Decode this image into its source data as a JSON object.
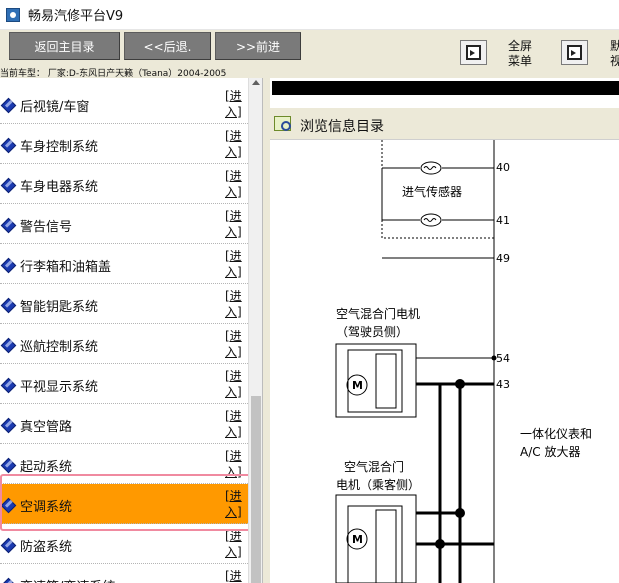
{
  "window": {
    "title": "畅易汽修平台V9"
  },
  "toolbar": {
    "back_main": "返回主目录",
    "back": "<<后退.",
    "forward": ">>前进",
    "fullscreen_line1": "全屏",
    "fullscreen_line2": "菜单",
    "view_line1": "默",
    "view_line2": "视"
  },
  "model_info": "当前车型：  厂家:D-东风日产天籁（Teana）2004-2005",
  "sidebar": {
    "enter_label": "[进入]",
    "items": [
      {
        "label": "后视镜/车窗"
      },
      {
        "label": "车身控制系统"
      },
      {
        "label": "车身电器系统"
      },
      {
        "label": "警告信号"
      },
      {
        "label": "行李箱和油箱盖"
      },
      {
        "label": "智能钥匙系统"
      },
      {
        "label": "巡航控制系统"
      },
      {
        "label": "平视显示系统"
      },
      {
        "label": "真空管路"
      },
      {
        "label": "起动系统"
      },
      {
        "label": "空调系统",
        "selected": true
      },
      {
        "label": "防盗系统"
      },
      {
        "label": "变速箱/变速系统"
      }
    ]
  },
  "content": {
    "browse_title": "浏览信息目录",
    "diagram": {
      "sensor_label": "进气传感器",
      "motor1_label_line1": "空气混合门电机",
      "motor1_label_line2": "（驾驶员侧）",
      "motor2_label_line1": "空气混合门",
      "motor2_label_line2": "电机（乘客侧）",
      "amplifier_line1": "一体化仪表和",
      "amplifier_line2": "A/C 放大器",
      "pins": [
        "40",
        "41",
        "49",
        "54",
        "43"
      ],
      "motor_symbol": "M"
    }
  }
}
